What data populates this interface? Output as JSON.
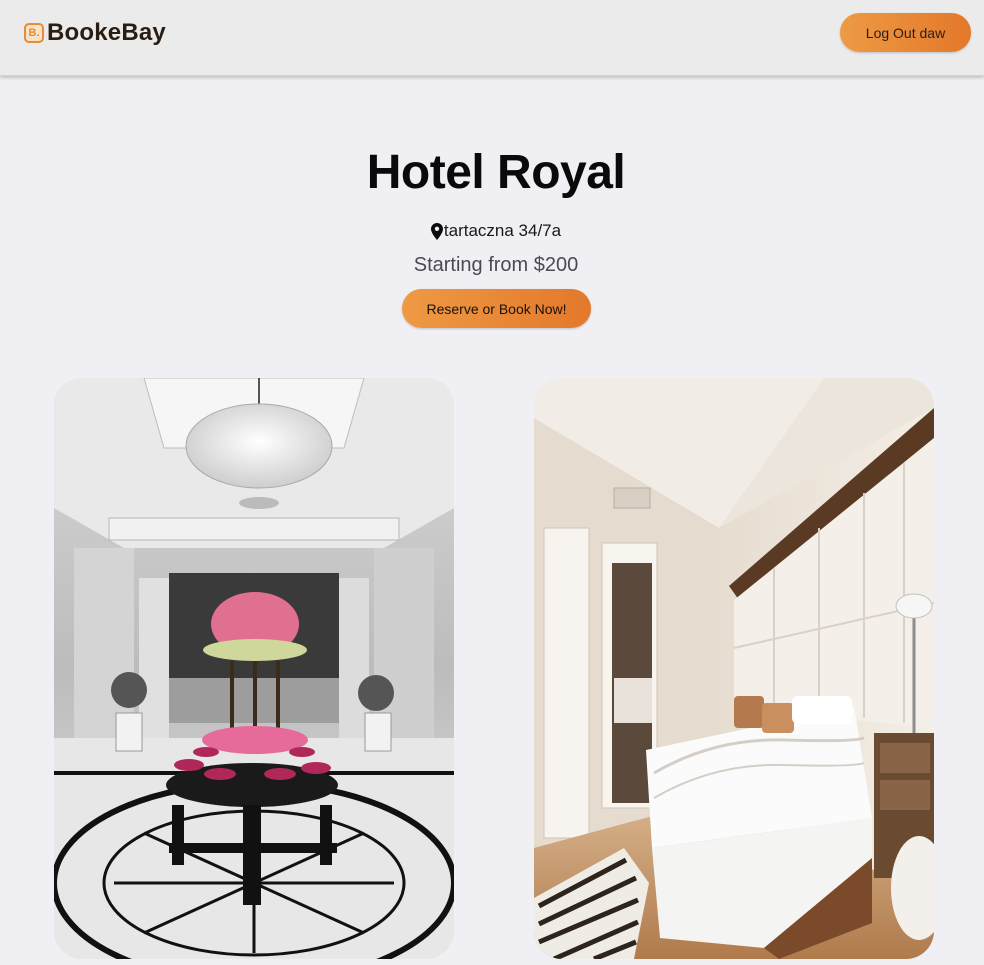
{
  "header": {
    "brand": {
      "logo_glyph": "B.",
      "name": "BookeBay"
    },
    "logout_label": "Log Out daw"
  },
  "hotel": {
    "name": "Hotel Royal",
    "address": "tartaczna 34/7a",
    "price_text": "Starting from $200",
    "reserve_label": "Reserve or Book Now!"
  },
  "gallery": [
    {
      "name": "lobby-photo",
      "subject": "grand lobby with chandelier and flower arrangement"
    },
    {
      "name": "bedroom-photo",
      "subject": "bedroom with white bed and marble floor"
    }
  ],
  "colors": {
    "accent_start": "#ee9a45",
    "accent_end": "#e3782a",
    "background": "#efeff4",
    "header": "#ebebeb"
  }
}
